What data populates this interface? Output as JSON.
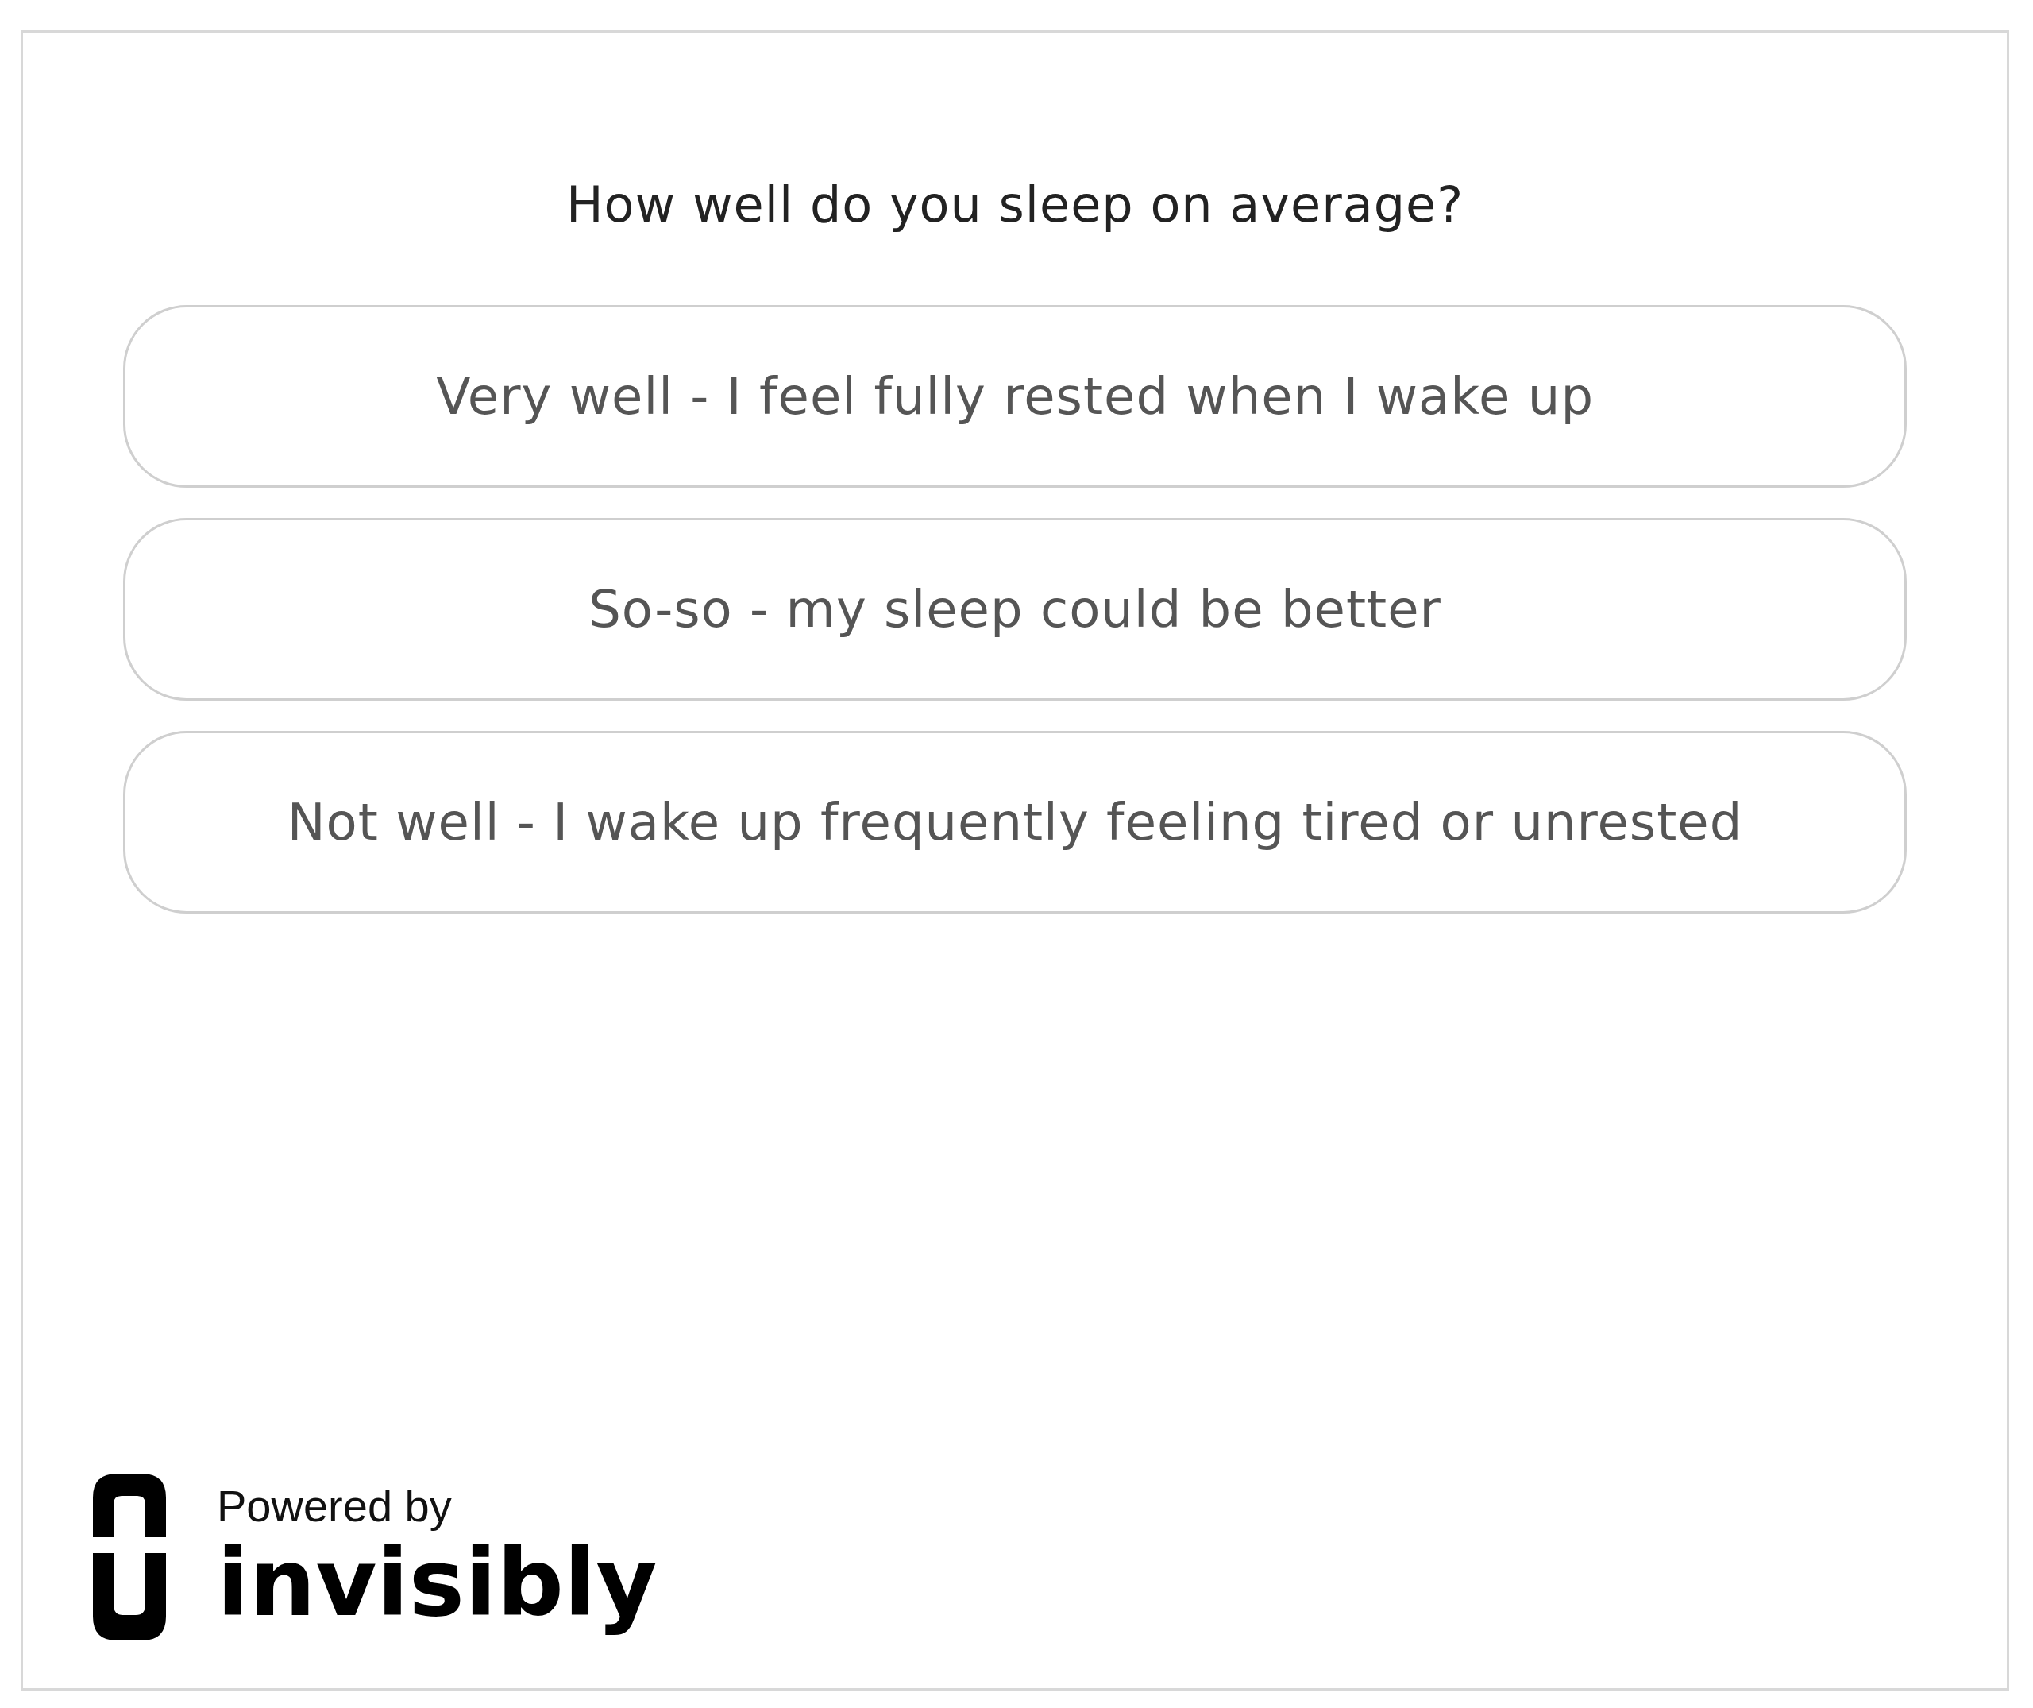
{
  "question": "How well do you sleep on average?",
  "options": [
    {
      "label": "Very well - I feel fully rested when I wake up"
    },
    {
      "label": "So-so - my sleep could be better"
    },
    {
      "label": "Not well - I wake up frequently feeling tired or unrested"
    }
  ],
  "footer": {
    "powered_by": "Powered by",
    "brand": "invisibly"
  }
}
